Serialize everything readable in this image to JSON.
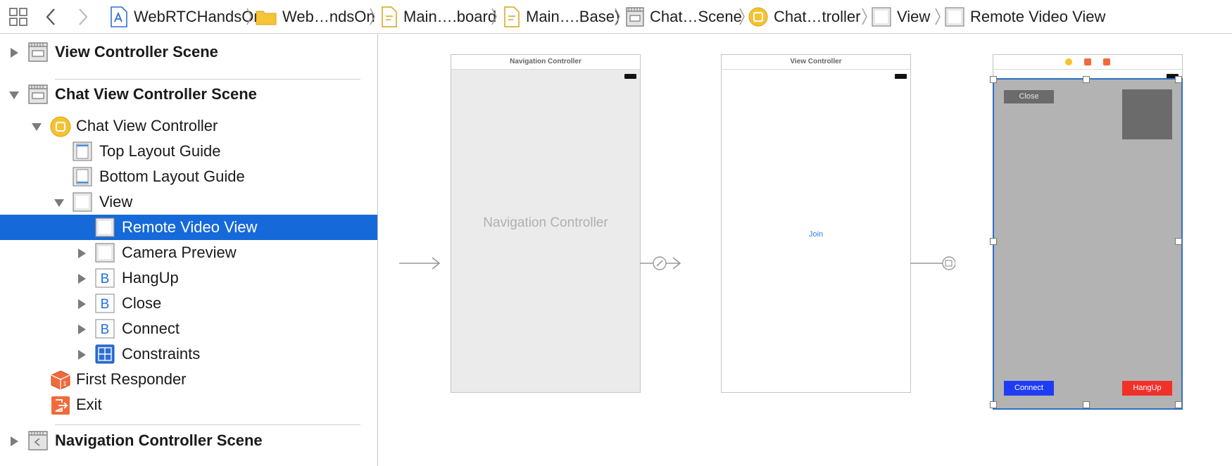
{
  "breadcrumbs": [
    {
      "label": "WebRTCHandsOn",
      "icon": "app-project-icon"
    },
    {
      "label": "Web…ndsOn",
      "icon": "folder-icon"
    },
    {
      "label": "Main….board",
      "icon": "storyboard-file-icon"
    },
    {
      "label": "Main….Base)",
      "icon": "storyboard-file-icon"
    },
    {
      "label": "Chat…Scene",
      "icon": "scene-icon"
    },
    {
      "label": "Chat…troller",
      "icon": "view-controller-icon"
    },
    {
      "label": "View",
      "icon": "view-icon"
    },
    {
      "label": "Remote Video View",
      "icon": "view-icon"
    }
  ],
  "outline": {
    "rows": [
      {
        "label": "View Controller Scene",
        "icon": "scene-icon",
        "bold": true,
        "expanded": false
      },
      {
        "label": "Chat View Controller Scene",
        "icon": "scene-icon",
        "bold": true,
        "expanded": true
      },
      {
        "label": "Chat View Controller",
        "icon": "view-controller-icon",
        "expanded": true
      },
      {
        "label": "Top Layout Guide",
        "icon": "layout-guide-icon"
      },
      {
        "label": "Bottom Layout Guide",
        "icon": "layout-guide-icon"
      },
      {
        "label": "View",
        "icon": "view-icon",
        "expanded": true
      },
      {
        "label": "Remote Video View",
        "icon": "view-icon",
        "selected": true
      },
      {
        "label": "Camera Preview",
        "icon": "view-icon",
        "expanded": false
      },
      {
        "label": "HangUp",
        "icon": "button-icon",
        "icon_letter": "B",
        "expanded": false
      },
      {
        "label": "Close",
        "icon": "button-icon",
        "icon_letter": "B",
        "expanded": false
      },
      {
        "label": "Connect",
        "icon": "button-icon",
        "icon_letter": "B",
        "expanded": false
      },
      {
        "label": "Constraints",
        "icon": "constraints-icon",
        "expanded": false
      },
      {
        "label": "First Responder",
        "icon": "first-responder-icon"
      },
      {
        "label": "Exit",
        "icon": "exit-icon"
      },
      {
        "label": "Navigation Controller Scene",
        "icon": "scene-icon",
        "bold": true,
        "expanded": false
      }
    ]
  },
  "canvas": {
    "nav_scene": {
      "title": "Navigation Controller",
      "body_label": "Navigation Controller"
    },
    "vc_scene": {
      "title": "View Controller",
      "join_label": "Join"
    },
    "chat_scene": {
      "close_label": "Close",
      "connect_label": "Connect",
      "hangup_label": "HangUp"
    }
  },
  "colors": {
    "selection": "#1569d9",
    "connect_button": "#1f3cf5",
    "hangup_button": "#f1302a",
    "close_button": "#6b6b6b",
    "chat_background": "#b3b3b3",
    "camera_preview": "#6b6b6b",
    "nav_background": "#ebebeb",
    "link_blue": "#2f7cf6"
  }
}
